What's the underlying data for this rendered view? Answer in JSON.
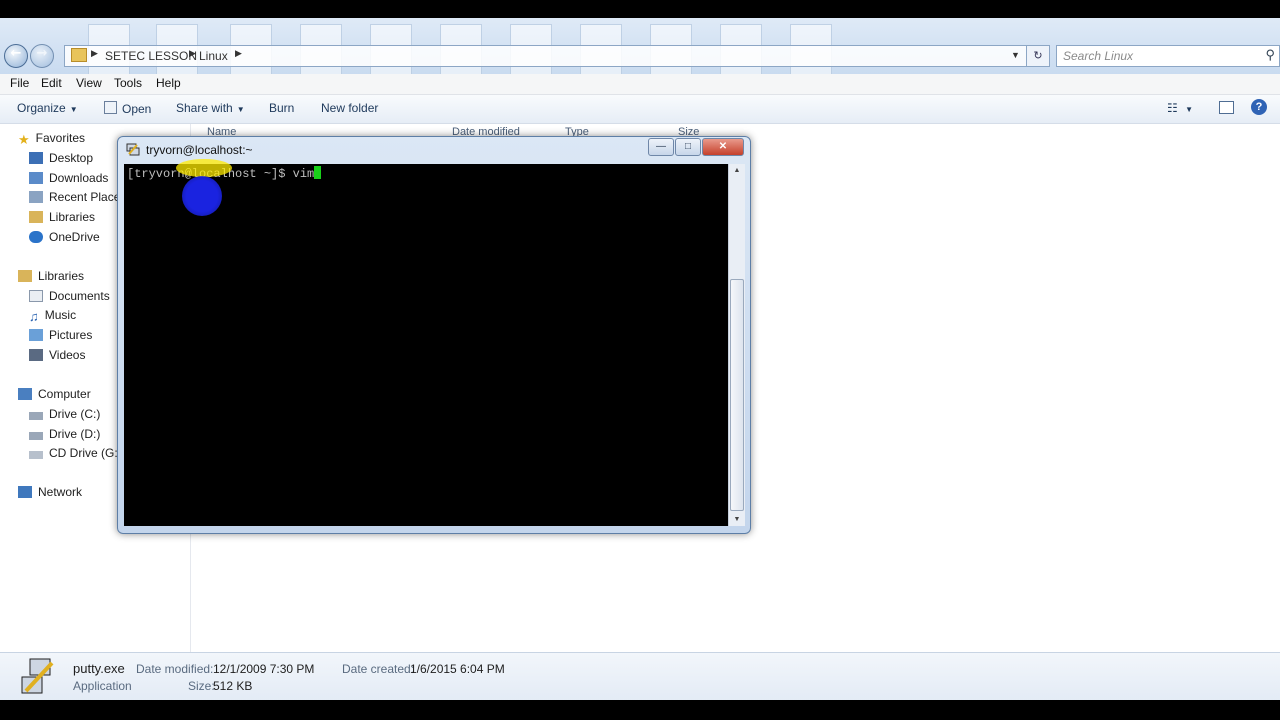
{
  "address": {
    "crumbs": [
      "SETEC LESSON",
      "Linux"
    ],
    "search_placeholder": "Search Linux"
  },
  "menu": [
    "File",
    "Edit",
    "View",
    "Tools",
    "Help"
  ],
  "toolbar": {
    "organize": "Organize",
    "open": "Open",
    "share_with": "Share with",
    "burn": "Burn",
    "new_folder": "New folder"
  },
  "columns": [
    "Name",
    "Date modified",
    "Type",
    "Size"
  ],
  "nav": {
    "favorites": "Favorites",
    "favorites_items": [
      "Desktop",
      "Downloads",
      "Recent Places",
      "Libraries",
      "OneDrive"
    ],
    "libraries": "Libraries",
    "libraries_items": [
      "Documents",
      "Music",
      "Pictures",
      "Videos"
    ],
    "computer": "Computer",
    "computer_items": [
      "Drive (C:)",
      "Drive (D:)",
      "CD Drive (G:)"
    ],
    "network": "Network"
  },
  "putty": {
    "title": "tryvorn@localhost:~",
    "prompt": "[tryvorn@localhost ~]$ vim"
  },
  "details": {
    "filename": "putty.exe",
    "filetype": "Application",
    "date_modified_label": "Date modified:",
    "date_modified": "12/1/2009 7:30 PM",
    "size_label": "Size:",
    "size": "512 KB",
    "date_created_label": "Date created:",
    "date_created": "1/6/2015 6:04 PM"
  },
  "colors": {
    "cursor": "#19d119",
    "terminal_bg": "#000000",
    "highlight": "#1a23e0"
  }
}
